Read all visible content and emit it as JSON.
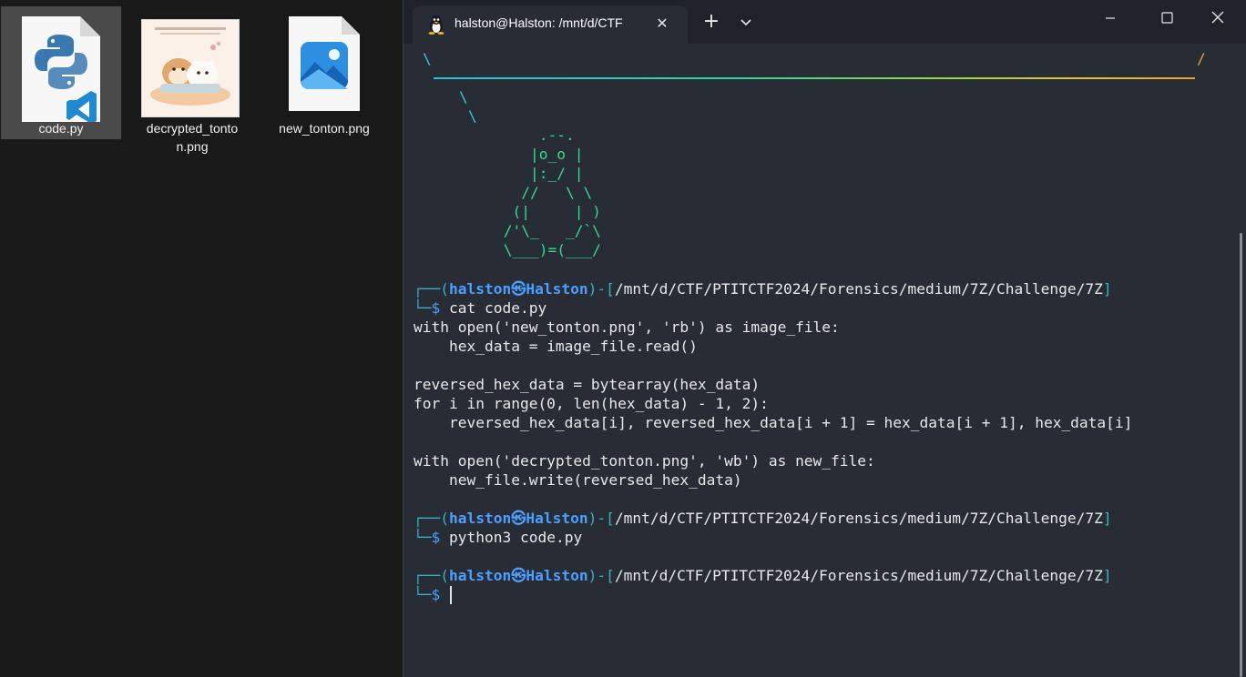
{
  "desktop": {
    "files": [
      {
        "name": "code.py",
        "icon": "python-vscode-file-icon",
        "selected": true
      },
      {
        "name": "decrypted_tonton.png",
        "label_line1": "decrypted_tonto",
        "label_line2": "n.png",
        "icon": "image-thumbnail-icon"
      },
      {
        "name": "new_tonton.png",
        "icon": "image-file-icon"
      }
    ]
  },
  "terminal": {
    "tab_title": "halston@Halston: /mnt/d/CTF",
    "tab_close": "✕",
    "new_tab": "+",
    "banner": {
      "left_slash": "\\",
      "right_slash": "/",
      "tail": [
        "\\",
        "\\"
      ]
    },
    "tux_art": [
      "         .--.",
      "        |o_o |",
      "        |:_/ |",
      "       //   \\ \\",
      "      (|     | )",
      "     /'\\_   _/`\\",
      "     \\___)=(___/"
    ],
    "prompt": {
      "open": "┌──(",
      "user": "halston",
      "sep": "㉿",
      "host": "Halston",
      "mid": ")-[",
      "path": "/mnt/d/CTF/PTITCTF2024/Forensics/medium/7Z/Challenge/7Z",
      "close": "]",
      "second": "└─",
      "dollar": "$"
    },
    "commands": [
      "cat code.py",
      "python3 code.py",
      ""
    ],
    "code_output": [
      "with open('new_tonton.png', 'rb') as image_file:",
      "    hex_data = image_file.read()",
      "",
      "reversed_hex_data = bytearray(hex_data)",
      "for i in range(0, len(hex_data) - 1, 2):",
      "    reversed_hex_data[i], reversed_hex_data[i + 1] = hex_data[i + 1], hex_data[i]",
      "",
      "with open('decrypted_tonton.png', 'wb') as new_file:",
      "    new_file.write(reversed_hex_data)"
    ]
  },
  "colors": {
    "terminal_bg": "#272c35",
    "titlebar_bg": "#1f2229",
    "prompt_user": "#4aa0ff",
    "prompt_frame": "#37b2c0",
    "path_green": "#39d98a",
    "tux_green": "#32dc8e",
    "banner_cyan": "#37c9d8",
    "banner_orange": "#f0a030"
  }
}
